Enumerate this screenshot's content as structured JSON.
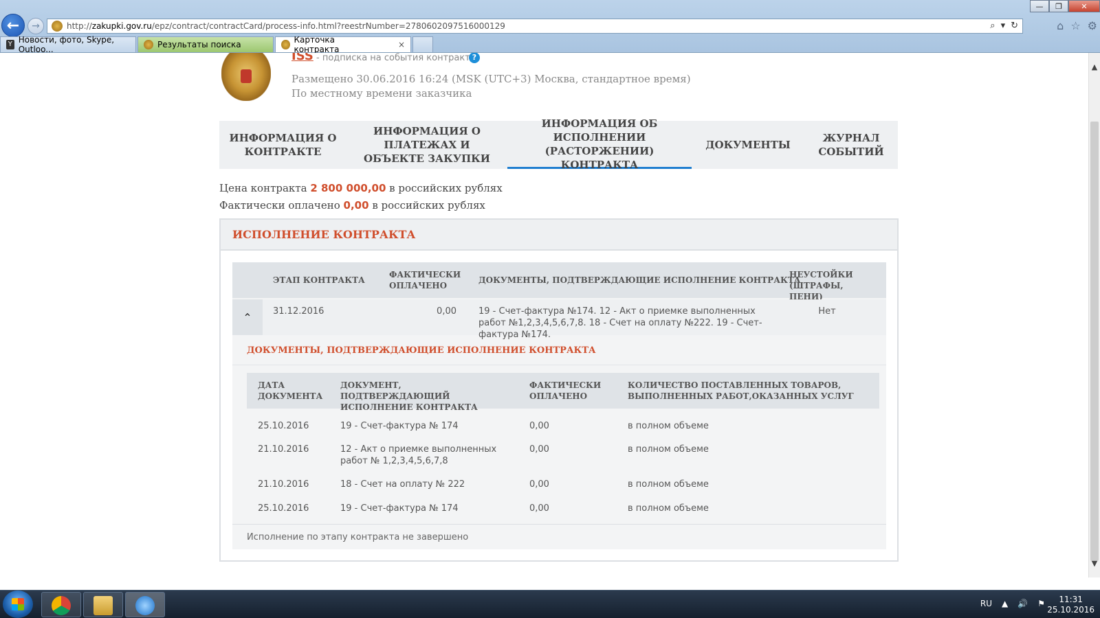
{
  "browser": {
    "url_prefix": "http://",
    "url_host": "zakupki.gov.ru",
    "url_path": "/epz/contract/contractCard/process-info.html?reestrNumber=2780602097516000129",
    "tabs": [
      {
        "label": "Новости, фото, Skype, Outloo..."
      },
      {
        "label": "Результаты поиска"
      },
      {
        "label": "Карточка контракта"
      }
    ],
    "tab_close": "×"
  },
  "header": {
    "link": "ISS",
    "subscribe": "- подписка на события контракта",
    "help": "?",
    "placed": "Размещено 30.06.2016 16:24 (MSK (UTC+3) Москва, стандартное время)",
    "local_time": "По местному времени заказчика"
  },
  "nav": {
    "tabs": [
      {
        "label": "ИНФОРМАЦИЯ О КОНТРАКТЕ"
      },
      {
        "label": "ИНФОРМАЦИЯ О ПЛАТЕЖАХ И ОБЪЕКТЕ ЗАКУПКИ"
      },
      {
        "label": "ИНФОРМАЦИЯ ОБ ИСПОЛНЕНИИ (РАСТОРЖЕНИИ) КОНТРАКТА"
      },
      {
        "label": "ДОКУМЕНТЫ"
      },
      {
        "label": "ЖУРНАЛ СОБЫТИЙ"
      }
    ]
  },
  "summary": {
    "price_prefix": "Цена контракта",
    "price_value": "2 800 000,00",
    "price_suffix": "в российских рублях",
    "paid_prefix": "Фактически оплачено",
    "paid_value": "0,00",
    "paid_suffix": "в российских рублях"
  },
  "execution": {
    "title": "ИСПОЛНЕНИЕ КОНТРАКТА",
    "headers": {
      "stage": "ЭТАП КОНТРАКТА",
      "paid": "ФАКТИЧЕСКИ ОПЛАЧЕНО",
      "docs": "ДОКУМЕНТЫ, ПОДТВЕРЖДАЮЩИЕ ИСПОЛНЕНИЕ КОНТРАКТА",
      "penalties": "НЕУСТОЙКИ (ШТРАФЫ, ПЕНИ)"
    },
    "stage": {
      "date": "31.12.2016",
      "paid": "0,00",
      "docs": "19 - Счет-фактура №174. 12 - Акт о приемке выполненных работ №1,2,3,4,5,6,7,8. 18 - Счет на оплату №222. 19 - Счет-фактура №174.",
      "penalties": "Нет"
    },
    "docs_title": "ДОКУМЕНТЫ, ПОДТВЕРЖДАЮЩИЕ ИСПОЛНЕНИЕ КОНТРАКТА",
    "docs_headers": {
      "date": "ДАТА ДОКУМЕНТА",
      "doc": "ДОКУМЕНТ, ПОДТВЕРЖДАЮЩИЙ ИСПОЛНЕНИЕ КОНТРАКТА",
      "paid": "ФАКТИЧЕСКИ ОПЛАЧЕНО",
      "qty": "КОЛИЧЕСТВО ПОСТАВЛЕННЫХ ТОВАРОВ, ВЫПОЛНЕННЫХ РАБОТ,ОКАЗАННЫХ УСЛУГ"
    },
    "docs": [
      {
        "date": "25.10.2016",
        "doc": "19 - Счет-фактура № 174",
        "paid": "0,00",
        "qty": "в полном объеме"
      },
      {
        "date": "21.10.2016",
        "doc": "12 - Акт о приемке выполненных работ № 1,2,3,4,5,6,7,8",
        "paid": "0,00",
        "qty": "в полном объеме"
      },
      {
        "date": "21.10.2016",
        "doc": "18 - Счет на оплату № 222",
        "paid": "0,00",
        "qty": "в полном объеме"
      },
      {
        "date": "25.10.2016",
        "doc": "19 - Счет-фактура № 174",
        "paid": "0,00",
        "qty": "в полном объеме"
      }
    ],
    "footer": "Исполнение по этапу контракта не завершено"
  },
  "taskbar": {
    "lang": "RU",
    "time": "11:31",
    "date": "25.10.2016"
  }
}
